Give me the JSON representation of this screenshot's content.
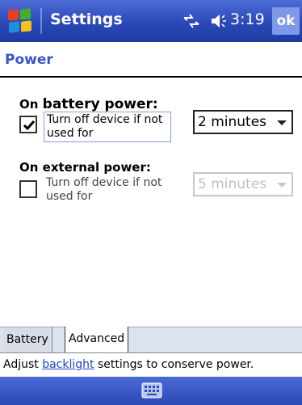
{
  "titlebar": {
    "app_title": "Settings",
    "time": "3:19",
    "ok_label": "ok"
  },
  "page": {
    "title": "Power"
  },
  "battery_section": {
    "heading_prefix": "On ",
    "heading_main": "battery power:",
    "checkbox_checked": true,
    "description": "Turn off device if not used for",
    "selected_value": "2 minutes"
  },
  "external_section": {
    "heading": "On external power:",
    "checkbox_checked": false,
    "description": "Turn off device if not used for",
    "selected_value": "5 minutes",
    "enabled": false
  },
  "tabs": [
    {
      "label": "Battery",
      "active": false
    },
    {
      "label": "Advanced",
      "active": true
    }
  ],
  "status": {
    "prefix": "Adjust ",
    "link": "backlight",
    "suffix": " settings to conserve power."
  },
  "colors": {
    "titlebar": "#2a49b8",
    "page_title": "#3a55c8",
    "link": "#1f44c8"
  },
  "icons": {
    "start": "windows-flag-icon",
    "connectivity": "connectivity-icon",
    "volume": "speaker-icon",
    "keyboard": "keyboard-icon"
  }
}
